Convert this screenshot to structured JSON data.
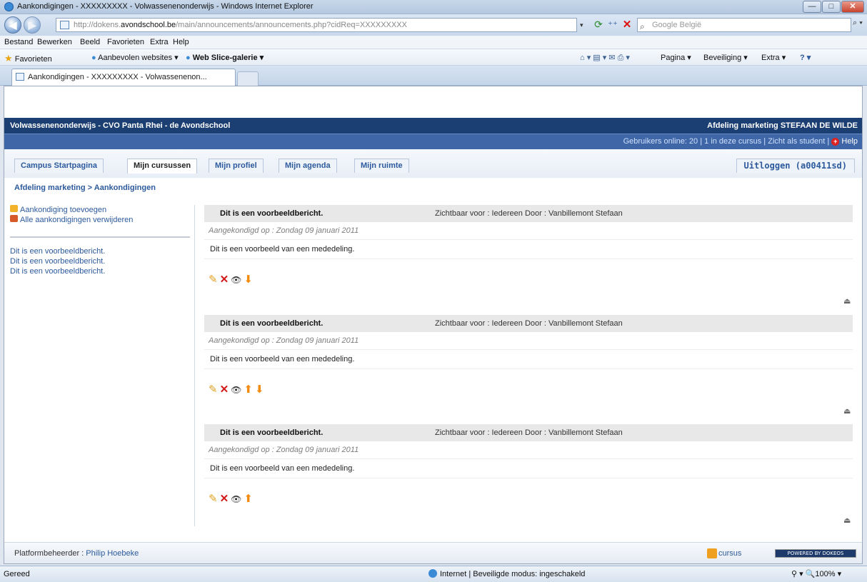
{
  "window": {
    "title": "Aankondigingen - XXXXXXXXX - Volwassenenonderwijs - Windows Internet Explorer",
    "min": "—",
    "max": "□",
    "close": "✕"
  },
  "nav": {
    "back": "◀",
    "forward": "▶",
    "url_prefix": "http://dokens.",
    "url_domain": "avondschool.be",
    "url_rest": "/main/announcements/announcements.php?cidReq=XXXXXXXXX",
    "search_placeholder": "Google België",
    "search_btn": "⌕ ▾",
    "dropdown": "▾",
    "refresh": "⟳",
    "fwd2": "⁺⁺",
    "stop": "✕",
    "search_icon": "⌕"
  },
  "menu": [
    "Bestand",
    "Bewerken",
    "Beeld",
    "Favorieten",
    "Extra",
    "Help"
  ],
  "favbar": {
    "favorites": "Favorieten",
    "recommended": "Aanbevolen websites ▾",
    "webslice": "Web Slice-galerie ▾",
    "tools": "⌂ ▾  ▤ ▾  ✉  ⎙ ▾",
    "pagina": "Pagina ▾",
    "beveiliging": "Beveiliging ▾",
    "extra": "Extra ▾",
    "help": "? ▾"
  },
  "browser_tab": "Aankondigingen - XXXXXXXXX - Volwassenenon...",
  "site": {
    "header_left": "Volwassenenonderwijs - CVO Panta Rhei - de Avondschool",
    "header_right": "Afdeling marketing STEFAAN DE WILDE",
    "users_online": "Gebruikers online: 20",
    "in_course": "1 in deze cursus",
    "student_view": "Zicht als student",
    "help": "Help",
    "help_icon": "+",
    "sep": " | ",
    "tabs": [
      "Campus Startpagina",
      "Mijn cursussen",
      "Mijn profiel",
      "Mijn agenda",
      "Mijn ruimte"
    ],
    "logout": "Uitloggen (a00411sd)",
    "breadcrumb": "Afdeling marketing > Aankondigingen"
  },
  "sidebar": {
    "add": "Aankondiging toevoegen",
    "delete_all": "Alle aankondigingen verwijderen",
    "links": [
      "Dit is een voorbeeldbericht.",
      "Dit is een voorbeeldbericht.",
      "Dit is een voorbeeldbericht."
    ]
  },
  "announcements": [
    {
      "title": "Dit is een voorbeeldbericht.",
      "visibility": "Zichtbaar voor :  Iedereen   Door :  Vanbillemont Stefaan",
      "date": "Aangekondigd op : Zondag 09 januari 2011",
      "body": "Dit is een voorbeeld van een mededeling."
    },
    {
      "title": "Dit is een voorbeeldbericht.",
      "visibility": "Zichtbaar voor :  Iedereen   Door :  Vanbillemont Stefaan",
      "date": "Aangekondigd op : Zondag 09 januari 2011",
      "body": "Dit is een voorbeeld van een mededeling."
    },
    {
      "title": "Dit is een voorbeeldbericht.",
      "visibility": "Zichtbaar voor :  Iedereen   Door :  Vanbillemont Stefaan",
      "date": "Aangekondigd op : Zondag 09 januari 2011",
      "body": "Dit is een voorbeeld van een mededeling."
    }
  ],
  "icons": {
    "edit": "✎",
    "delete": "✕",
    "visible": "👁",
    "up": "⬆",
    "down": "⬇",
    "top": "⏏"
  },
  "footer": {
    "admin_label": "Platformbeheerder :",
    "admin_name": "Philip Hoebeke",
    "cursus": "cursus",
    "powered": "POWERED BY DOKEOS"
  },
  "status": {
    "left": "Gereed",
    "zone": "Internet | Beveiligde modus: ingeschakeld",
    "zoom": "⚲ ▾  🔍100%  ▾"
  }
}
